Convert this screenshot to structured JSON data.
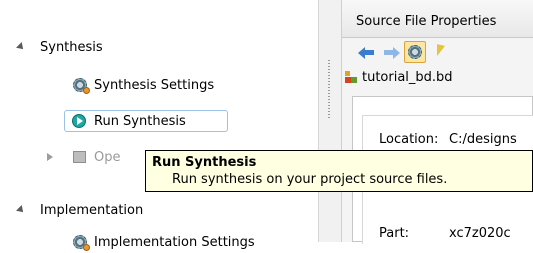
{
  "nav": {
    "synthesis_label": "Synthesis",
    "synthesis_settings_label": "Synthesis Settings",
    "run_synthesis_label": "Run Synthesis",
    "open_partial_label": "Ope",
    "implementation_label": "Implementation",
    "implementation_settings_label": "Implementation Settings"
  },
  "tooltip": {
    "title": "Run Synthesis",
    "body": "Run synthesis on your project source files."
  },
  "right_pane": {
    "tab_title": "Source File Properties",
    "file_name": "tutorial_bd.bd",
    "location_label": "Location:",
    "location_value": "C:/designs",
    "part_label": "Part:",
    "part_value": "xc7z020c"
  },
  "icons": [
    "gear-icon",
    "run-icon",
    "open-icon",
    "back-arrow-icon",
    "forward-arrow-icon",
    "select-icon",
    "hierarchy-icon"
  ],
  "colors": {
    "selection_border": "#9dc2e6",
    "tooltip_bg": "#ffffe1",
    "run_icon": "#1ea7a4"
  }
}
